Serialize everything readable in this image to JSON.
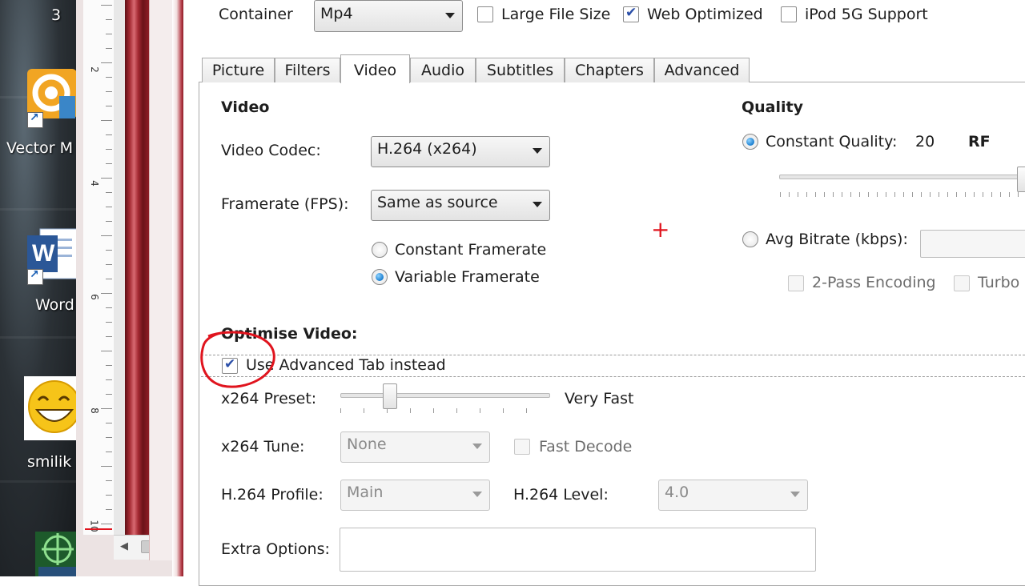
{
  "desktop": {
    "top_number": "3",
    "icons": [
      {
        "label": "Vector M",
        "icon": "vector-magic-icon"
      },
      {
        "label": "Word",
        "icon": "word-icon"
      },
      {
        "label": "smilik",
        "icon": "smiley-icon"
      }
    ],
    "word_letter": "W"
  },
  "ruler": {
    "numbers": [
      "2",
      "4",
      "6",
      "8",
      "10"
    ]
  },
  "header": {
    "container_label": "Container",
    "container_value": "Mp4",
    "large_file_size": {
      "label": "Large File Size",
      "checked": false
    },
    "web_optimized": {
      "label": "Web Optimized",
      "checked": true
    },
    "ipod_support": {
      "label": "iPod 5G Support",
      "checked": false
    }
  },
  "tabs": [
    {
      "label": "Picture",
      "active": false
    },
    {
      "label": "Filters",
      "active": false
    },
    {
      "label": "Video",
      "active": true
    },
    {
      "label": "Audio",
      "active": false
    },
    {
      "label": "Subtitles",
      "active": false
    },
    {
      "label": "Chapters",
      "active": false
    },
    {
      "label": "Advanced",
      "active": false
    }
  ],
  "video": {
    "heading": "Video",
    "codec_label": "Video Codec:",
    "codec_value": "H.264 (x264)",
    "framerate_label": "Framerate (FPS):",
    "framerate_value": "Same as source",
    "constant_framerate": {
      "label": "Constant Framerate",
      "selected": false
    },
    "variable_framerate": {
      "label": "Variable Framerate",
      "selected": true
    }
  },
  "quality": {
    "heading": "Quality",
    "constant_quality": {
      "label": "Constant Quality:",
      "value": "20",
      "unit": "RF",
      "selected": true
    },
    "slider_level": 0.97,
    "avg_bitrate": {
      "label": "Avg Bitrate (kbps):",
      "value": "",
      "selected": false
    },
    "two_pass": {
      "label": "2-Pass Encoding",
      "checked": false
    },
    "turbo": {
      "label": "Turbo",
      "checked": false
    }
  },
  "marker": "+",
  "optimise": {
    "heading": "Optimise Video:",
    "use_advanced": {
      "label": "Use Advanced Tab instead",
      "checked": true
    },
    "preset_label": "x264 Preset:",
    "preset_value": "Very Fast",
    "preset_level": 0.22,
    "tune_label": "x264 Tune:",
    "tune_value": "None",
    "fast_decode": {
      "label": "Fast Decode",
      "checked": false
    },
    "profile_label": "H.264 Profile:",
    "profile_value": "Main",
    "level_label": "H.264 Level:",
    "level_value": "4.0",
    "extra_label": "Extra Options:",
    "extra_value": ""
  },
  "colors": {
    "annotation_red": "#e0141e",
    "radio_blue": "#1c7fd0",
    "check_blue": "#2b4fa8"
  }
}
